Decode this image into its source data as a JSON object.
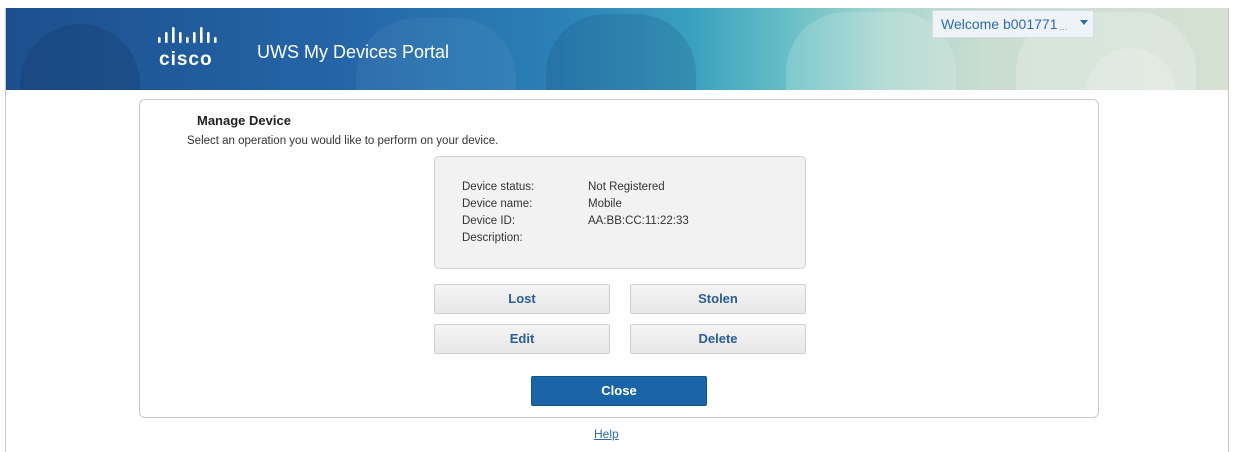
{
  "header": {
    "logo_text": "cisco",
    "portal_title": "UWS My Devices Portal",
    "welcome_text": "Welcome b001771",
    "welcome_more": "...",
    "colors": {
      "header_dark": "#1d4f8e",
      "header_light": "#d6e0d3",
      "link_blue": "#2e6aa6"
    }
  },
  "panel": {
    "title": "Manage Device",
    "subtitle": "Select an operation you would like to perform on your device.",
    "device_info": [
      {
        "label": "Device status:",
        "value": "Not Registered"
      },
      {
        "label": "Device name:",
        "value": "Mobile"
      },
      {
        "label": "Device ID:",
        "value": "AA:BB:CC:11:22:33"
      },
      {
        "label": "Description:",
        "value": ""
      }
    ],
    "actions": {
      "lost": "Lost",
      "stolen": "Stolen",
      "edit": "Edit",
      "delete": "Delete",
      "close": "Close"
    },
    "colors": {
      "primary_button": "#1a64a8",
      "secondary_button_text": "#2b5d94"
    }
  },
  "footer": {
    "help_link": "Help"
  }
}
